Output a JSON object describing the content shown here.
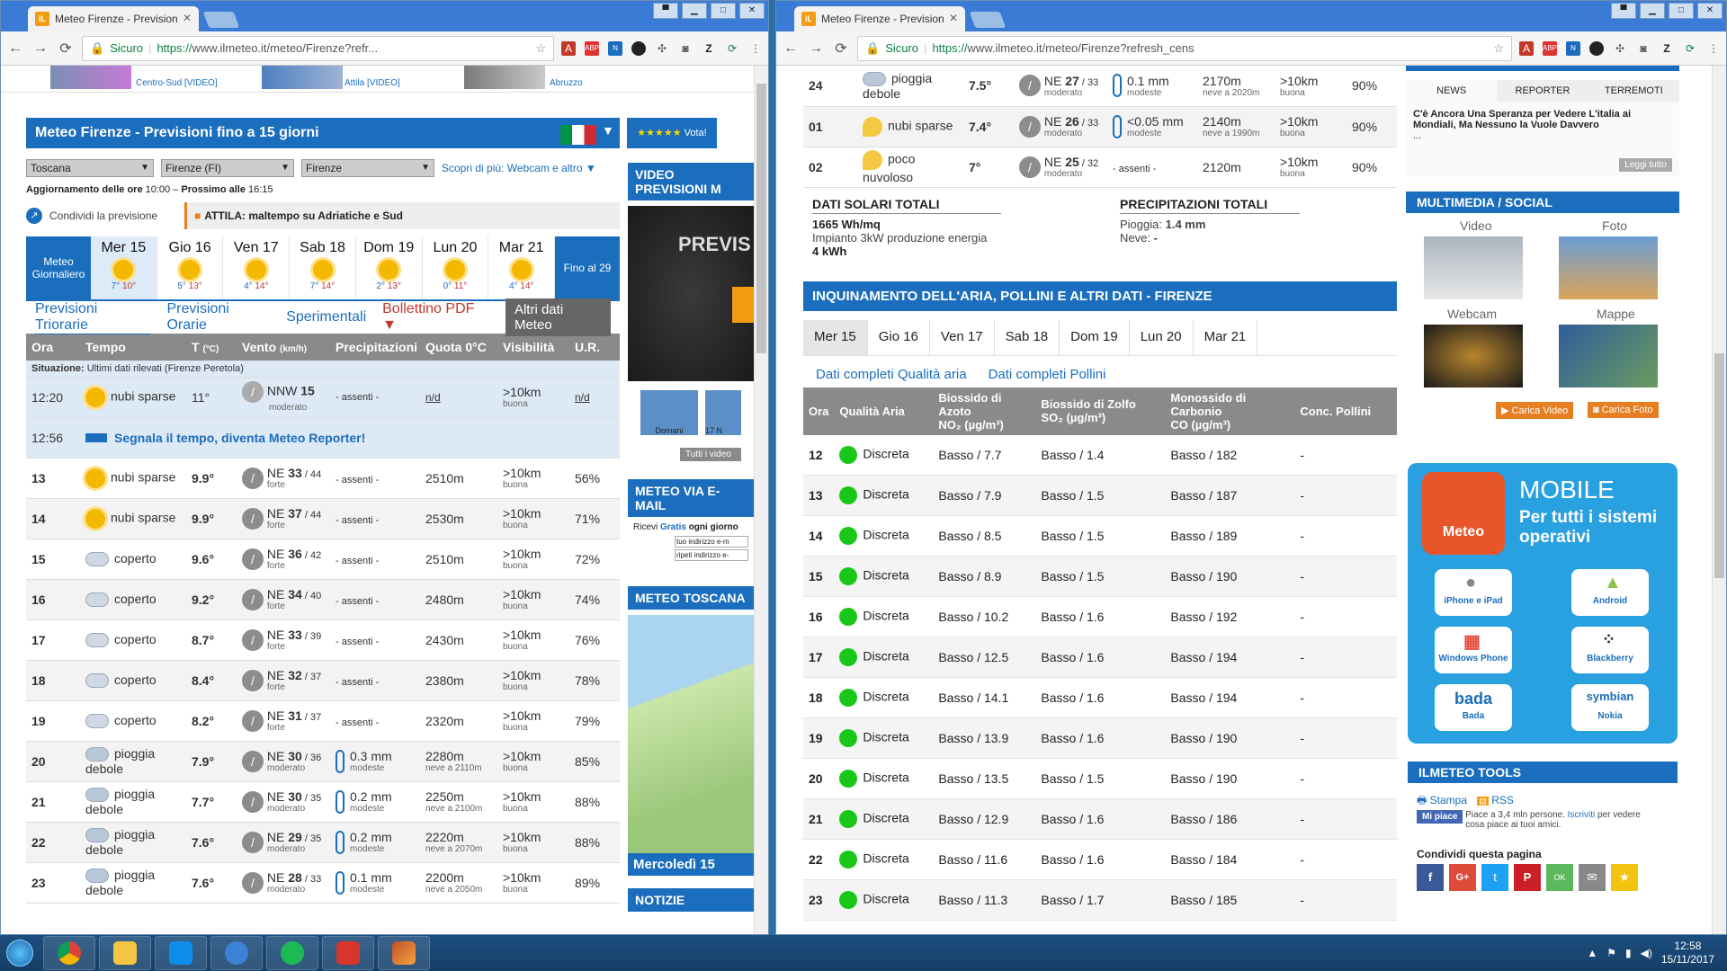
{
  "left_window": {
    "tab_title": "Meteo Firenze - Prevision",
    "omnibox": {
      "secure_label": "Sicuro",
      "url_https": "https://",
      "url_rest": "www.ilmeteo.it/meteo/Firenze?refr..."
    },
    "promo": {
      "item1": "Centro-Sud [VIDEO]",
      "item2": "Attila [VIDEO]",
      "item3": "Abruzzo"
    },
    "title": "Meteo Firenze - Previsioni fino a 15 giorni",
    "vota": "Vota!",
    "selects": {
      "region": "Toscana",
      "province": "Firenze (FI)",
      "city": "Firenze",
      "more": "Scopri di più: Webcam e altro"
    },
    "update": {
      "label": "Aggiornamento delle ore",
      "time": "10:00",
      "next_label": "Prossimo alle",
      "next_time": "16:15"
    },
    "share": "Condividi la previsione",
    "alert": "ATTILA: maltempo su Adriatiche e Sud",
    "meteo_giornaliero": "Meteo Giornaliero",
    "fino": "Fino al 29",
    "days": [
      {
        "name": "Mer 15",
        "min": "7°",
        "max": "10°"
      },
      {
        "name": "Gio 16",
        "min": "5°",
        "max": "13°"
      },
      {
        "name": "Ven 17",
        "min": "4°",
        "max": "14°"
      },
      {
        "name": "Sab 18",
        "min": "7°",
        "max": "14°"
      },
      {
        "name": "Dom 19",
        "min": "2°",
        "max": "13°"
      },
      {
        "name": "Lun 20",
        "min": "0°",
        "max": "11°"
      },
      {
        "name": "Mar 21",
        "min": "4°",
        "max": "14°"
      }
    ],
    "subtabs": {
      "t1": "Previsioni Triorarie",
      "t2": "Previsioni Orarie",
      "t3": "Sperimentali",
      "pdf": "Bollettino PDF",
      "other": "Altri dati Meteo"
    },
    "headers": {
      "ora": "Ora",
      "tempo": "Tempo",
      "temp": "T",
      "temp_unit": "(°C)",
      "vento": "Vento",
      "vento_unit": "(km/h)",
      "prec": "Precipitazioni",
      "quota": "Quota 0°C",
      "vis": "Visibilità",
      "ur": "U.R."
    },
    "situazione": "Situazione:",
    "situazione_note": "Ultimi dati rilevati (Firenze Peretola)",
    "current": {
      "ora": "12:20",
      "tempo": "nubi sparse",
      "t": "11°",
      "vento": "NNW",
      "vs": "15",
      "vq": "moderato",
      "prec": "- assenti -",
      "quota": "n/d",
      "vis": ">10km",
      "visq": "buona",
      "ur": "n/d"
    },
    "reporter": {
      "ora": "12:56",
      "text": "Segnala il tempo, diventa Meteo Reporter!"
    },
    "rows": [
      {
        "ora": "13",
        "tempo": "nubi sparse",
        "icon": "sun",
        "t": "9.9°",
        "vento": "NE",
        "vs": "33",
        "vr": "44",
        "vq": "forte",
        "prec": "- assenti -",
        "pq": "",
        "quota": "2510m",
        "qn": "",
        "vis": ">10km",
        "visq": "buona",
        "ur": "56%"
      },
      {
        "ora": "14",
        "tempo": "nubi sparse",
        "icon": "sun",
        "t": "9.9°",
        "vento": "NE",
        "vs": "37",
        "vr": "44",
        "vq": "forte",
        "prec": "- assenti -",
        "pq": "",
        "quota": "2530m",
        "qn": "",
        "vis": ">10km",
        "visq": "buona",
        "ur": "71%"
      },
      {
        "ora": "15",
        "tempo": "coperto",
        "icon": "cloud",
        "t": "9.6°",
        "vento": "NE",
        "vs": "36",
        "vr": "42",
        "vq": "forte",
        "prec": "- assenti -",
        "pq": "",
        "quota": "2510m",
        "qn": "",
        "vis": ">10km",
        "visq": "buona",
        "ur": "72%"
      },
      {
        "ora": "16",
        "tempo": "coperto",
        "icon": "cloud",
        "t": "9.2°",
        "vento": "NE",
        "vs": "34",
        "vr": "40",
        "vq": "forte",
        "prec": "- assenti -",
        "pq": "",
        "quota": "2480m",
        "qn": "",
        "vis": ">10km",
        "visq": "buona",
        "ur": "74%"
      },
      {
        "ora": "17",
        "tempo": "coperto",
        "icon": "cloud",
        "t": "8.7°",
        "vento": "NE",
        "vs": "33",
        "vr": "39",
        "vq": "forte",
        "prec": "- assenti -",
        "pq": "",
        "quota": "2430m",
        "qn": "",
        "vis": ">10km",
        "visq": "buona",
        "ur": "76%"
      },
      {
        "ora": "18",
        "tempo": "coperto",
        "icon": "cloud",
        "t": "8.4°",
        "vento": "NE",
        "vs": "32",
        "vr": "37",
        "vq": "forte",
        "prec": "- assenti -",
        "pq": "",
        "quota": "2380m",
        "qn": "",
        "vis": ">10km",
        "visq": "buona",
        "ur": "78%"
      },
      {
        "ora": "19",
        "tempo": "coperto",
        "icon": "cloud",
        "t": "8.2°",
        "vento": "NE",
        "vs": "31",
        "vr": "37",
        "vq": "forte",
        "prec": "- assenti -",
        "pq": "",
        "quota": "2320m",
        "qn": "",
        "vis": ">10km",
        "visq": "buona",
        "ur": "79%"
      },
      {
        "ora": "20",
        "tempo": "pioggia debole",
        "icon": "rain",
        "t": "7.9°",
        "vento": "NE",
        "vs": "30",
        "vr": "36",
        "vq": "moderato",
        "prec": "0.3 mm",
        "pq": "modeste",
        "quota": "2280m",
        "qn": "neve a 2110m",
        "vis": ">10km",
        "visq": "buona",
        "ur": "85%"
      },
      {
        "ora": "21",
        "tempo": "pioggia debole",
        "icon": "rain",
        "t": "7.7°",
        "vento": "NE",
        "vs": "30",
        "vr": "35",
        "vq": "moderato",
        "prec": "0.2 mm",
        "pq": "modeste",
        "quota": "2250m",
        "qn": "neve a 2100m",
        "vis": ">10km",
        "visq": "buona",
        "ur": "88%"
      },
      {
        "ora": "22",
        "tempo": "pioggia debole",
        "icon": "rain",
        "t": "7.6°",
        "vento": "NE",
        "vs": "29",
        "vr": "35",
        "vq": "moderato",
        "prec": "0.2 mm",
        "pq": "modeste",
        "quota": "2220m",
        "qn": "neve a 2070m",
        "vis": ">10km",
        "visq": "buona",
        "ur": "88%"
      },
      {
        "ora": "23",
        "tempo": "pioggia debole",
        "icon": "rain",
        "t": "7.6°",
        "vento": "NE",
        "vs": "28",
        "vr": "33",
        "vq": "moderato",
        "prec": "0.1 mm",
        "pq": "modeste",
        "quota": "2200m",
        "qn": "neve a 2050m",
        "vis": ">10km",
        "visq": "buona",
        "ur": "89%"
      }
    ],
    "side": {
      "video": "VIDEO PREVISIONI M",
      "video_overlay": "PREVIS",
      "domani": "Domani",
      "seventeen": "17 N",
      "tutti": "Tutti i video",
      "email": "METEO VIA E-MAIL",
      "ricevi": "Ricevi",
      "gratis": "Gratis",
      "ogni": "ogni giorno",
      "tuo": "tuo indirizzo e-m",
      "ripeti": "ripeti indirizzo e-",
      "toscana": "METEO TOSCANA",
      "mercoledi": "Mercoledì 15",
      "notizie": "NOTIZIE"
    }
  },
  "right_window": {
    "tab_title": "Meteo Firenze - Prevision",
    "omnibox": {
      "secure_label": "Sicuro",
      "url_https": "https://",
      "url_rest": "www.ilmeteo.it/meteo/Firenze?refresh_cens"
    },
    "top_rows": [
      {
        "ora": "24",
        "tempo": "pioggia debole",
        "icon": "rain",
        "t": "7.5°",
        "vento": "NE",
        "vs": "27",
        "vr": "33",
        "vq": "moderato",
        "prec": "0.1 mm",
        "pq": "modeste",
        "quota": "2170m",
        "qn": "neve a 2020m",
        "vis": ">10km",
        "visq": "buona",
        "ur": "90%"
      },
      {
        "ora": "01",
        "tempo": "nubi sparse",
        "icon": "moon",
        "t": "7.4°",
        "vento": "NE",
        "vs": "26",
        "vr": "33",
        "vq": "moderato",
        "prec": "<0.05 mm",
        "pq": "modeste",
        "quota": "2140m",
        "qn": "neve a 1990m",
        "vis": ">10km",
        "visq": "buona",
        "ur": "90%"
      },
      {
        "ora": "02",
        "tempo": "poco nuvoloso",
        "icon": "moon",
        "t": "7°",
        "vento": "NE",
        "vs": "25",
        "vr": "32",
        "vq": "moderato",
        "prec": "- assenti -",
        "pq": "",
        "quota": "2120m",
        "qn": "",
        "vis": ">10km",
        "visq": "buona",
        "ur": "90%"
      }
    ],
    "solar": {
      "title": "DATI SOLARI TOTALI",
      "value": "1665 Wh/mq",
      "impianto": "Impianto 3kW produzione energia",
      "kwh": "4 kWh"
    },
    "precip": {
      "title": "PRECIPITAZIONI TOTALI",
      "pioggia_label": "Pioggia:",
      "pioggia": "1.4 mm",
      "neve_label": "Neve:",
      "neve": "-"
    },
    "aq_title": "INQUINAMENTO DELL'ARIA, POLLINI E ALTRI DATI - FIRENZE",
    "aq_days": [
      "Mer 15",
      "Gio 16",
      "Ven 17",
      "Sab 18",
      "Dom 19",
      "Lun 20",
      "Mar 21"
    ],
    "aq_links": {
      "l1": "Dati completi Qualità aria",
      "l2": "Dati completi Pollini"
    },
    "aq_headers": {
      "ora": "Ora",
      "qual": "Qualità Aria",
      "no2": "Biossido di Azoto",
      "no2u": "NO₂ (µg/m³)",
      "so2": "Biossido di Zolfo",
      "so2u": "SO₂ (µg/m³)",
      "co": "Monossido di Carbonio",
      "cou": "CO (µg/m³)",
      "poll": "Conc. Pollini"
    },
    "aq_rows": [
      {
        "ora": "12",
        "q": "Discreta",
        "no2": "Basso / 7.7",
        "so2": "Basso / 1.4",
        "co": "Basso / 182",
        "p": "-"
      },
      {
        "ora": "13",
        "q": "Discreta",
        "no2": "Basso / 7.9",
        "so2": "Basso / 1.5",
        "co": "Basso / 187",
        "p": "-"
      },
      {
        "ora": "14",
        "q": "Discreta",
        "no2": "Basso / 8.5",
        "so2": "Basso / 1.5",
        "co": "Basso / 189",
        "p": "-"
      },
      {
        "ora": "15",
        "q": "Discreta",
        "no2": "Basso / 8.9",
        "so2": "Basso / 1.5",
        "co": "Basso / 190",
        "p": "-"
      },
      {
        "ora": "16",
        "q": "Discreta",
        "no2": "Basso / 10.2",
        "so2": "Basso / 1.6",
        "co": "Basso / 192",
        "p": "-"
      },
      {
        "ora": "17",
        "q": "Discreta",
        "no2": "Basso / 12.5",
        "so2": "Basso / 1.6",
        "co": "Basso / 194",
        "p": "-"
      },
      {
        "ora": "18",
        "q": "Discreta",
        "no2": "Basso / 14.1",
        "so2": "Basso / 1.6",
        "co": "Basso / 194",
        "p": "-"
      },
      {
        "ora": "19",
        "q": "Discreta",
        "no2": "Basso / 13.9",
        "so2": "Basso / 1.6",
        "co": "Basso / 190",
        "p": "-"
      },
      {
        "ora": "20",
        "q": "Discreta",
        "no2": "Basso / 13.5",
        "so2": "Basso / 1.5",
        "co": "Basso / 190",
        "p": "-"
      },
      {
        "ora": "21",
        "q": "Discreta",
        "no2": "Basso / 12.9",
        "so2": "Basso / 1.6",
        "co": "Basso / 186",
        "p": "-"
      },
      {
        "ora": "22",
        "q": "Discreta",
        "no2": "Basso / 11.6",
        "so2": "Basso / 1.6",
        "co": "Basso / 184",
        "p": "-"
      },
      {
        "ora": "23",
        "q": "Discreta",
        "no2": "Basso / 11.3",
        "so2": "Basso / 1.7",
        "co": "Basso / 185",
        "p": "-"
      }
    ],
    "news_tabs": [
      "NEWS",
      "REPORTER",
      "TERREMOTI"
    ],
    "news_text": "C'è Ancora Una Speranza per Vedere L'italia ai Mondiali, Ma Nessuno la Vuole Davvero",
    "news_ellipsis": "...",
    "leggi": "Leggi tutto",
    "multimedia": "MULTIMEDIA / SOCIAL",
    "media": {
      "video": "Video",
      "foto": "Foto",
      "webcam": "Webcam",
      "mappe": "Mappe",
      "carica_video": "Carica Video",
      "carica_foto": "Carica Foto"
    },
    "mobile": {
      "logo": "Meteo",
      "title": "MOBILE",
      "sub": "Per tutti i sistemi operativi",
      "apps": [
        "iPhone e iPad",
        "Android",
        "Windows Phone",
        "Blackberry",
        "Bada",
        "Nokia"
      ],
      "bada": "bada",
      "symbian": "symbian"
    },
    "tools": {
      "title": "ILMETEO TOOLS",
      "stampa": "Stampa",
      "rss": "RSS",
      "mipiace": "Mi piace",
      "likes": "Piace a 3,4 mln persone.",
      "iscriviti": "Iscriviti",
      "likes2": "per vedere cosa piace ai tuoi amici.",
      "condividi": "Condividi questa pagina"
    }
  },
  "taskbar": {
    "time": "12:58",
    "date": "15/11/2017"
  }
}
